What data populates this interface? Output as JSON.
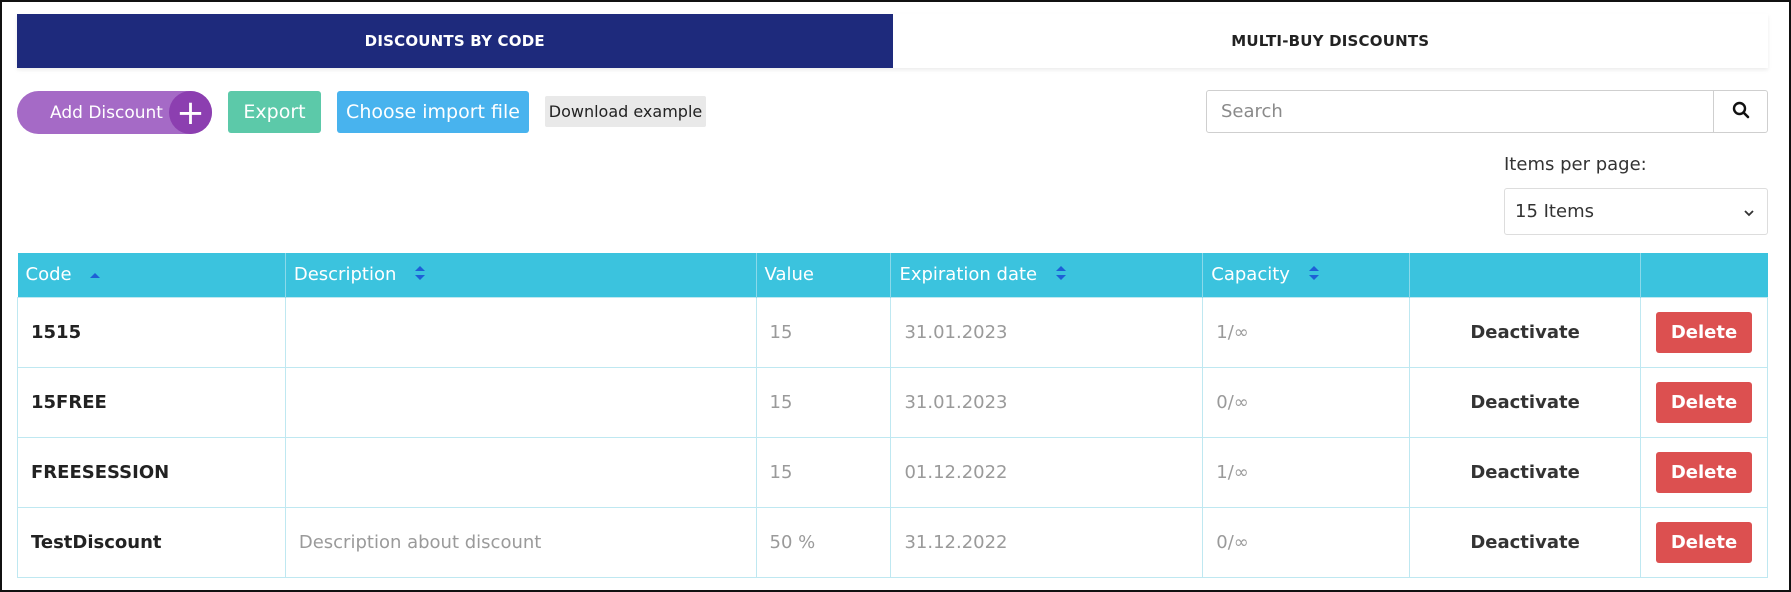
{
  "tabs": [
    {
      "label": "DISCOUNTS BY CODE",
      "active": true
    },
    {
      "label": "MULTI-BUY DISCOUNTS",
      "active": false
    }
  ],
  "toolbar": {
    "add_label": "Add Discount",
    "add_icon": "+",
    "export_label": "Export",
    "import_label": "Choose import file",
    "download_label": "Download example"
  },
  "search": {
    "placeholder": "Search",
    "value": ""
  },
  "pagination": {
    "items_per_page_label": "Items per page:",
    "selected": "15 Items"
  },
  "table": {
    "columns": [
      {
        "label": "Code",
        "sort": "asc"
      },
      {
        "label": "Description",
        "sort": "both"
      },
      {
        "label": "Value",
        "sort": "none"
      },
      {
        "label": "Expiration date",
        "sort": "both"
      },
      {
        "label": "Capacity",
        "sort": "both"
      },
      {
        "label": "",
        "sort": "none"
      },
      {
        "label": "",
        "sort": "none"
      }
    ],
    "rows": [
      {
        "code": "1515",
        "description": "",
        "value": "15",
        "expiration": "31.01.2023",
        "capacity": "1/∞",
        "action": "Deactivate",
        "delete": "Delete"
      },
      {
        "code": "15FREE",
        "description": "",
        "value": "15",
        "expiration": "31.01.2023",
        "capacity": "0/∞",
        "action": "Deactivate",
        "delete": "Delete"
      },
      {
        "code": "FREESESSION",
        "description": "",
        "value": "15",
        "expiration": "01.12.2022",
        "capacity": "1/∞",
        "action": "Deactivate",
        "delete": "Delete"
      },
      {
        "code": "TestDiscount",
        "description": "Description about discount",
        "value": "50 %",
        "expiration": "31.12.2022",
        "capacity": "0/∞",
        "action": "Deactivate",
        "delete": "Delete"
      }
    ]
  },
  "colors": {
    "tab_active": "#1e2a7c",
    "add": "#a56ac6",
    "export": "#5cc9a9",
    "import": "#48b3ee",
    "table_header": "#3bc3de",
    "delete": "#dc5050"
  },
  "icons": {
    "search": "search-icon",
    "chevron": "chevron-down-icon",
    "sort_asc": "sort-asc-icon",
    "sort_both": "sort-both-icon",
    "plus": "plus-icon"
  }
}
